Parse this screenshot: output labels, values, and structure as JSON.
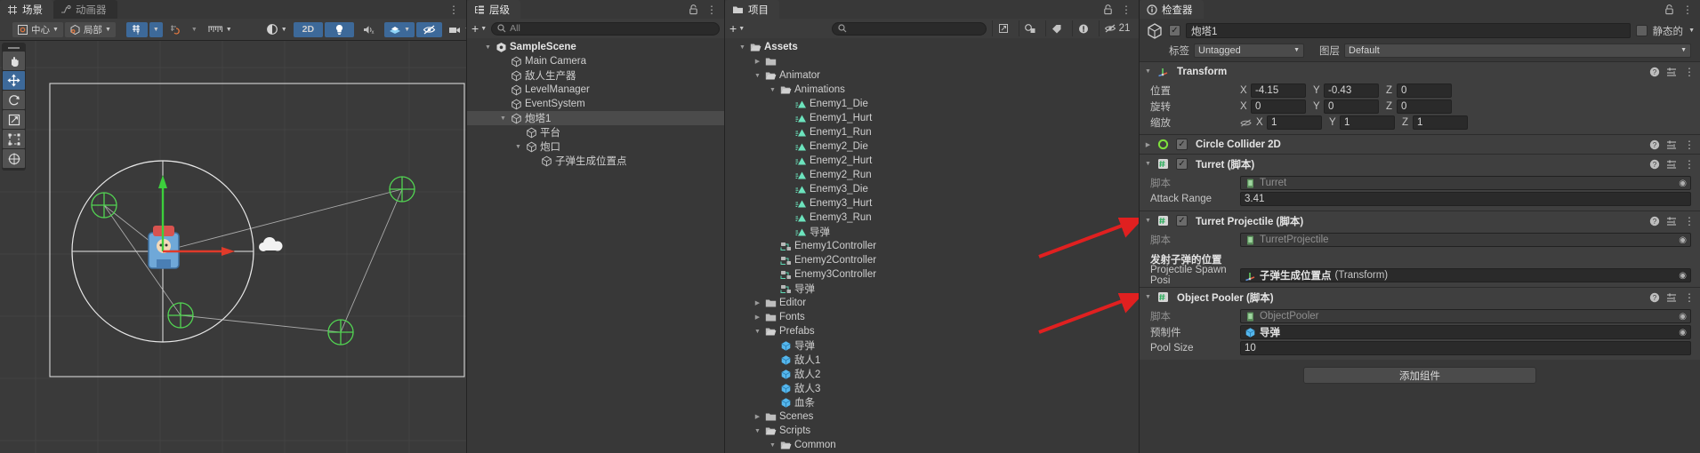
{
  "scene": {
    "tabs": [
      {
        "label": "场景",
        "icon": "grid-icon",
        "active": true
      },
      {
        "label": "动画器",
        "icon": "animator-icon",
        "active": false
      }
    ],
    "toolbar": {
      "pivot_label": "中心",
      "space_label": "局部",
      "grid_label": "grid-snap",
      "snap_label": "snap-increment",
      "ruler_label": "ruler",
      "shading_label": "shading-mode",
      "mode_2d": "2D",
      "light_label": "lighting-toggle",
      "audio_label": "audio-toggle",
      "fx_label": "effects-toggle",
      "hidden_label": "hidden-objects-toggle",
      "camera_label": "scene-camera",
      "gizmos_label": "gizmos-toggle"
    },
    "tools": [
      {
        "name": "hand-tool",
        "glyph": "✋",
        "active": false
      },
      {
        "name": "move-tool",
        "glyph": "✛",
        "active": true
      },
      {
        "name": "rotate-tool",
        "glyph": "↻",
        "active": false
      },
      {
        "name": "scale-tool",
        "glyph": "⤢",
        "active": false
      },
      {
        "name": "rect-tool",
        "glyph": "▣",
        "active": false
      },
      {
        "name": "transform-tool",
        "glyph": "✥",
        "active": false
      }
    ],
    "overflow_label": "⋮"
  },
  "hierarchy": {
    "tab": {
      "label": "层级",
      "icon": "hierarchy-icon"
    },
    "create_label": "+",
    "search_placeholder": "All",
    "items": [
      {
        "label": "SampleScene",
        "indent": 0,
        "arrow": "▼",
        "icon": "scene-icon",
        "bold": true,
        "selected": false
      },
      {
        "label": "Main Camera",
        "indent": 1,
        "arrow": "",
        "icon": "gameobject-icon",
        "bold": false,
        "selected": false
      },
      {
        "label": "敌人生产器",
        "indent": 1,
        "arrow": "",
        "icon": "gameobject-icon",
        "bold": false,
        "selected": false
      },
      {
        "label": "LevelManager",
        "indent": 1,
        "arrow": "",
        "icon": "gameobject-icon",
        "bold": false,
        "selected": false
      },
      {
        "label": "EventSystem",
        "indent": 1,
        "arrow": "",
        "icon": "gameobject-icon",
        "bold": false,
        "selected": false
      },
      {
        "label": "炮塔1",
        "indent": 1,
        "arrow": "▼",
        "icon": "gameobject-icon",
        "bold": false,
        "selected": true
      },
      {
        "label": "平台",
        "indent": 2,
        "arrow": "",
        "icon": "gameobject-icon",
        "bold": false,
        "selected": false
      },
      {
        "label": "炮口",
        "indent": 2,
        "arrow": "▼",
        "icon": "gameobject-icon",
        "bold": false,
        "selected": false
      },
      {
        "label": "子弹生成位置点",
        "indent": 3,
        "arrow": "",
        "icon": "gameobject-icon",
        "bold": false,
        "selected": false
      }
    ],
    "lock_label": "lock",
    "menu_label": "⋮"
  },
  "project": {
    "tab": {
      "label": "项目",
      "icon": "project-icon"
    },
    "create_label": "+",
    "search_placeholder": "",
    "items": [
      {
        "label": "Assets",
        "indent": 0,
        "arrow": "▼",
        "icon": "folder-open-icon",
        "bold": true
      },
      {
        "label": "",
        "indent": 1,
        "arrow": "▶",
        "icon": "folder-icon",
        "bold": false
      },
      {
        "label": "Animator",
        "indent": 1,
        "arrow": "▼",
        "icon": "folder-open-icon",
        "bold": false
      },
      {
        "label": "Animations",
        "indent": 2,
        "arrow": "▼",
        "icon": "folder-open-icon",
        "bold": false
      },
      {
        "label": "Enemy1_Die",
        "indent": 3,
        "arrow": "",
        "icon": "animation-clip-icon",
        "bold": false
      },
      {
        "label": "Enemy1_Hurt",
        "indent": 3,
        "arrow": "",
        "icon": "animation-clip-icon",
        "bold": false
      },
      {
        "label": "Enemy1_Run",
        "indent": 3,
        "arrow": "",
        "icon": "animation-clip-icon",
        "bold": false
      },
      {
        "label": "Enemy2_Die",
        "indent": 3,
        "arrow": "",
        "icon": "animation-clip-icon",
        "bold": false
      },
      {
        "label": "Enemy2_Hurt",
        "indent": 3,
        "arrow": "",
        "icon": "animation-clip-icon",
        "bold": false
      },
      {
        "label": "Enemy2_Run",
        "indent": 3,
        "arrow": "",
        "icon": "animation-clip-icon",
        "bold": false
      },
      {
        "label": "Enemy3_Die",
        "indent": 3,
        "arrow": "",
        "icon": "animation-clip-icon",
        "bold": false
      },
      {
        "label": "Enemy3_Hurt",
        "indent": 3,
        "arrow": "",
        "icon": "animation-clip-icon",
        "bold": false
      },
      {
        "label": "Enemy3_Run",
        "indent": 3,
        "arrow": "",
        "icon": "animation-clip-icon",
        "bold": false
      },
      {
        "label": "导弹",
        "indent": 3,
        "arrow": "",
        "icon": "animation-clip-icon",
        "bold": false
      },
      {
        "label": "Enemy1Controller",
        "indent": 2,
        "arrow": "",
        "icon": "animator-controller-icon",
        "bold": false
      },
      {
        "label": "Enemy2Controller",
        "indent": 2,
        "arrow": "",
        "icon": "animator-controller-icon",
        "bold": false
      },
      {
        "label": "Enemy3Controller",
        "indent": 2,
        "arrow": "",
        "icon": "animator-controller-icon",
        "bold": false
      },
      {
        "label": "导弹",
        "indent": 2,
        "arrow": "",
        "icon": "animator-controller-icon",
        "bold": false
      },
      {
        "label": "Editor",
        "indent": 1,
        "arrow": "▶",
        "icon": "folder-icon",
        "bold": false
      },
      {
        "label": "Fonts",
        "indent": 1,
        "arrow": "▶",
        "icon": "folder-icon",
        "bold": false
      },
      {
        "label": "Prefabs",
        "indent": 1,
        "arrow": "▼",
        "icon": "folder-open-icon",
        "bold": false
      },
      {
        "label": "导弹",
        "indent": 2,
        "arrow": "",
        "icon": "prefab-icon",
        "bold": false
      },
      {
        "label": "敌人1",
        "indent": 2,
        "arrow": "",
        "icon": "prefab-icon",
        "bold": false
      },
      {
        "label": "敌人2",
        "indent": 2,
        "arrow": "",
        "icon": "prefab-icon",
        "bold": false
      },
      {
        "label": "敌人3",
        "indent": 2,
        "arrow": "",
        "icon": "prefab-icon",
        "bold": false
      },
      {
        "label": "血条",
        "indent": 2,
        "arrow": "",
        "icon": "prefab-icon",
        "bold": false
      },
      {
        "label": "Scenes",
        "indent": 1,
        "arrow": "▶",
        "icon": "folder-icon",
        "bold": false
      },
      {
        "label": "Scripts",
        "indent": 1,
        "arrow": "▼",
        "icon": "folder-open-icon",
        "bold": false
      },
      {
        "label": "Common",
        "indent": 2,
        "arrow": "▼",
        "icon": "folder-open-icon",
        "bold": false
      }
    ],
    "lock_label": "lock",
    "menu_label": "⋮",
    "status_tools": {
      "hidden_count": "21"
    }
  },
  "inspector": {
    "tab": {
      "label": "检查器",
      "icon": "inspector-icon"
    },
    "lock_label": "lock",
    "menu_label": "⋮",
    "object_name": "炮塔1",
    "enabled": true,
    "static_label": "静态的",
    "tag_label": "标签",
    "tag_value": "Untagged",
    "layer_label": "图层",
    "layer_value": "Default",
    "components": [
      {
        "name": "Transform",
        "icon": "transform-icon",
        "expanded": true,
        "has_checkbox": false,
        "fields": [
          {
            "type": "vector3",
            "label": "位置",
            "x": "-4.15",
            "y": "-0.43",
            "z": "0"
          },
          {
            "type": "vector3",
            "label": "旋转",
            "x": "0",
            "y": "0",
            "z": "0"
          },
          {
            "type": "vector3",
            "label": "缩放",
            "x": "1",
            "y": "1",
            "z": "1",
            "link_icon": true
          }
        ]
      },
      {
        "name": "Circle Collider 2D",
        "icon": "circle-collider-icon",
        "expanded": false,
        "has_checkbox": true,
        "checked": true,
        "fields": []
      },
      {
        "name": "Turret  (脚本)",
        "icon": "script-icon",
        "expanded": true,
        "has_checkbox": true,
        "checked": true,
        "fields": [
          {
            "type": "object",
            "label": "脚本",
            "value": "Turret",
            "readonly": true
          },
          {
            "type": "number",
            "label": "Attack Range",
            "value": "3.41"
          }
        ]
      },
      {
        "name": "Turret Projectile  (脚本)",
        "icon": "script-icon",
        "expanded": true,
        "has_checkbox": true,
        "checked": true,
        "fields": [
          {
            "type": "object",
            "label": "脚本",
            "value": "TurretProjectile",
            "readonly": true
          },
          {
            "type": "header",
            "label": "发射子弹的位置"
          },
          {
            "type": "object",
            "label": "Projectile Spawn Posi",
            "value": "子弹生成位置点",
            "suffix": " (Transform)",
            "readonly": false,
            "icon": "transform-icon"
          }
        ]
      },
      {
        "name": "Object Pooler  (脚本)",
        "icon": "script-icon",
        "expanded": true,
        "has_checkbox": false,
        "fields": [
          {
            "type": "object",
            "label": "脚本",
            "value": "ObjectPooler",
            "readonly": true
          },
          {
            "type": "object",
            "label": "预制件",
            "value": "导弹",
            "readonly": false,
            "icon": "prefab-icon"
          },
          {
            "type": "number",
            "label": "Pool Size",
            "value": "10"
          }
        ]
      }
    ],
    "add_component_label": "添加组件"
  },
  "colors": {
    "accent_blue": "#3d6999",
    "panel_bg": "#383838",
    "component_bg": "#3f3f3f",
    "field_bg": "#2a2a2a",
    "annotation_red": "#e02020",
    "gizmo_green": "#3ccf3c",
    "gizmo_red": "#e03a2a",
    "collider_green": "#8ef08e"
  }
}
